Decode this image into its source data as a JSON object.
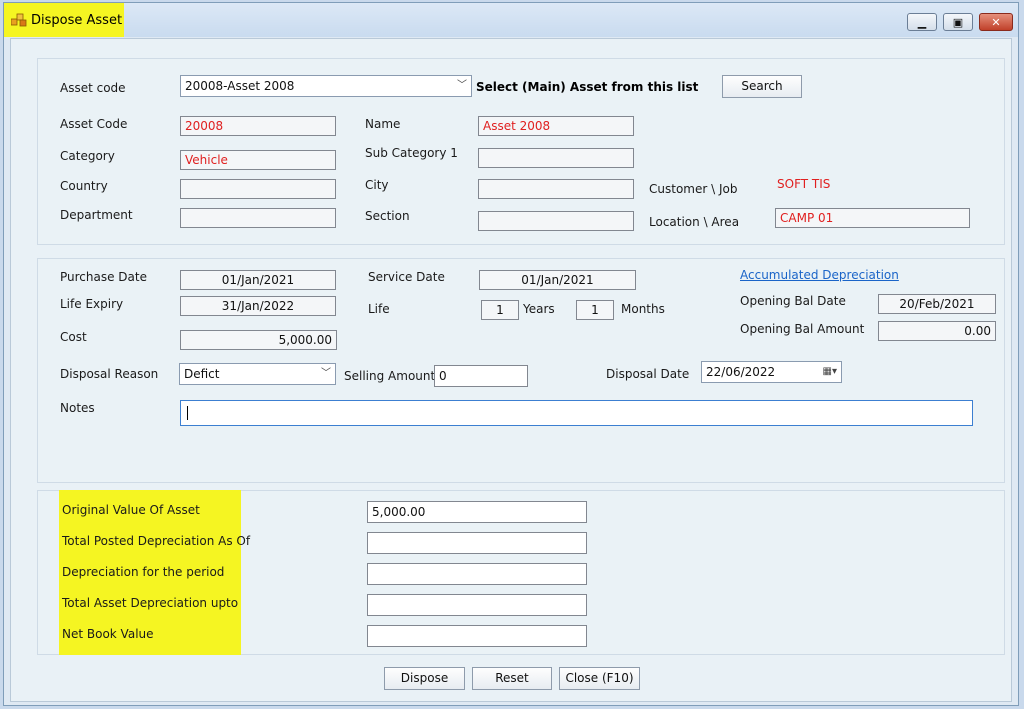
{
  "window": {
    "title": "Dispose Asset"
  },
  "header": {
    "asset_code_label": "Asset code",
    "asset_code_value": "20008-Asset 2008",
    "select_hint": "Select (Main) Asset from this list",
    "search_button": "Search"
  },
  "info": {
    "asset_code": {
      "label": "Asset Code",
      "value": "20008"
    },
    "name": {
      "label": "Name",
      "value": "Asset 2008"
    },
    "category": {
      "label": "Category",
      "value": "Vehicle"
    },
    "sub_category": {
      "label": "Sub Category 1",
      "value": ""
    },
    "country": {
      "label": "Country",
      "value": ""
    },
    "city": {
      "label": "City",
      "value": ""
    },
    "customer_job": {
      "label": "Customer \\ Job",
      "value": "SOFT TIS"
    },
    "department": {
      "label": "Department",
      "value": ""
    },
    "section": {
      "label": "Section",
      "value": ""
    },
    "location_area": {
      "label": "Location \\ Area",
      "value": "CAMP 01"
    }
  },
  "details": {
    "purchase_date": {
      "label": "Purchase Date",
      "value": "01/Jan/2021"
    },
    "service_date": {
      "label": "Service Date",
      "value": "01/Jan/2021"
    },
    "accumulated_depreciation_link": "Accumulated Depreciation",
    "life_expiry": {
      "label": "Life Expiry",
      "value": "31/Jan/2022"
    },
    "life": {
      "label": "Life",
      "years": "1",
      "years_label": "Years",
      "months": "1",
      "months_label": "Months"
    },
    "opening_bal_date": {
      "label": "Opening Bal Date",
      "value": "20/Feb/2021"
    },
    "cost": {
      "label": "Cost",
      "value": "5,000.00"
    },
    "opening_bal_amount": {
      "label": "Opening Bal Amount",
      "value": "0.00"
    },
    "disposal_reason": {
      "label": "Disposal Reason",
      "value": "Defict"
    },
    "selling_amount": {
      "label": "Selling Amount",
      "value": "0"
    },
    "disposal_date": {
      "label": "Disposal Date",
      "value": "22/06/2022"
    },
    "notes": {
      "label": "Notes",
      "value": ""
    }
  },
  "summary": {
    "original_value": {
      "label": "Original Value Of Asset",
      "value": "5,000.00"
    },
    "total_posted_dep": {
      "label": "Total Posted  Depreciation As Of",
      "value": ""
    },
    "dep_for_period": {
      "label": "Depreciation for the period",
      "value": ""
    },
    "total_asset_dep": {
      "label": "Total Asset Depreciation upto",
      "value": ""
    },
    "net_book_value": {
      "label": "Net Book Value",
      "value": ""
    }
  },
  "footer": {
    "dispose_button": "Dispose",
    "reset_button": "Reset",
    "close_button": "Close (F10)"
  },
  "colors": {
    "highlight": "#f5f522",
    "red_text": "#e02020",
    "link": "#1a64c8"
  },
  "icons": [
    "app-icon",
    "minimize-icon",
    "maximize-icon",
    "close-icon",
    "chevron-down-icon",
    "calendar-icon"
  ]
}
